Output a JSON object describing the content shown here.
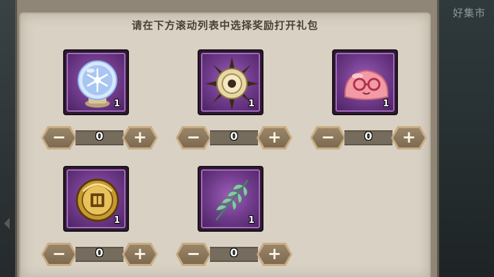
{
  "side_text": "好集市",
  "title": "请在下方滚动列表中选择奖励打开礼包",
  "colors": {
    "frame_purple": "#6f3a8a",
    "frame_border": "#a46ac0",
    "stepper_brown": "#8a7558",
    "panel_bg": "#d8d1c4"
  },
  "items": [
    {
      "icon": "crystal-ball-icon",
      "qty": "1",
      "count": "0",
      "minus": "−",
      "plus": "+"
    },
    {
      "icon": "sun-emblem-icon",
      "qty": "1",
      "count": "0",
      "minus": "−",
      "plus": "+"
    },
    {
      "icon": "pink-slime-glasses-icon",
      "qty": "1",
      "count": "0",
      "minus": "−",
      "plus": "+"
    },
    {
      "icon": "gold-coin-icon",
      "qty": "1",
      "count": "0",
      "minus": "−",
      "plus": "+"
    },
    {
      "icon": "feather-leaf-icon",
      "qty": "1",
      "count": "0",
      "minus": "−",
      "plus": "+"
    }
  ]
}
